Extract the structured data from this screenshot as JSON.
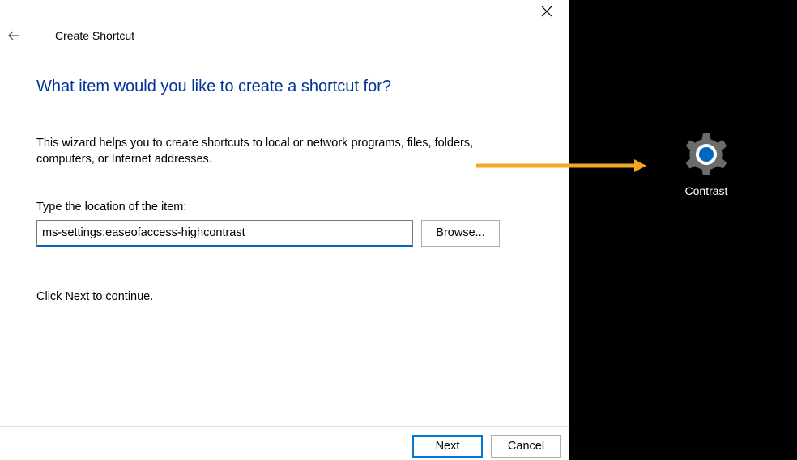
{
  "wizard": {
    "title": "Create Shortcut",
    "heading": "What item would you like to create a shortcut for?",
    "description": "This wizard helps you to create shortcuts to local or network programs, files, folders, computers, or Internet addresses.",
    "fieldLabel": "Type the location of the item:",
    "locationValue": "ms-settings:easeofaccess-highcontrast",
    "browseLabel": "Browse...",
    "continueText": "Click Next to continue.",
    "nextLabel": "Next",
    "cancelLabel": "Cancel"
  },
  "desktop": {
    "shortcutLabel": "Contrast"
  }
}
